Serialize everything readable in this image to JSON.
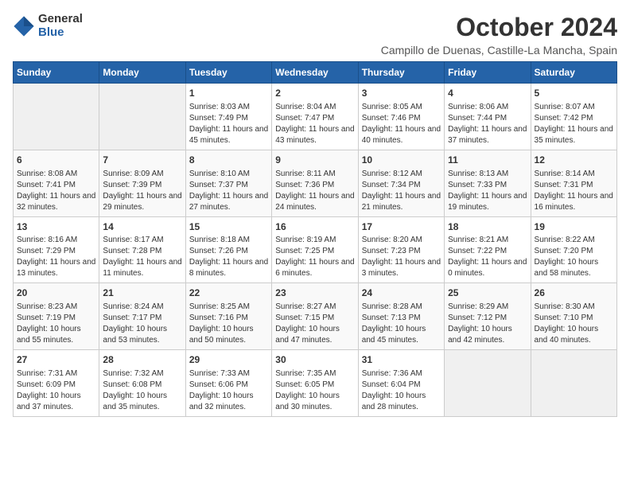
{
  "logo": {
    "general": "General",
    "blue": "Blue"
  },
  "title": {
    "month_year": "October 2024",
    "location": "Campillo de Duenas, Castille-La Mancha, Spain"
  },
  "calendar": {
    "headers": [
      "Sunday",
      "Monday",
      "Tuesday",
      "Wednesday",
      "Thursday",
      "Friday",
      "Saturday"
    ],
    "weeks": [
      [
        {
          "day": "",
          "info": ""
        },
        {
          "day": "",
          "info": ""
        },
        {
          "day": "1",
          "info": "Sunrise: 8:03 AM\nSunset: 7:49 PM\nDaylight: 11 hours and 45 minutes."
        },
        {
          "day": "2",
          "info": "Sunrise: 8:04 AM\nSunset: 7:47 PM\nDaylight: 11 hours and 43 minutes."
        },
        {
          "day": "3",
          "info": "Sunrise: 8:05 AM\nSunset: 7:46 PM\nDaylight: 11 hours and 40 minutes."
        },
        {
          "day": "4",
          "info": "Sunrise: 8:06 AM\nSunset: 7:44 PM\nDaylight: 11 hours and 37 minutes."
        },
        {
          "day": "5",
          "info": "Sunrise: 8:07 AM\nSunset: 7:42 PM\nDaylight: 11 hours and 35 minutes."
        }
      ],
      [
        {
          "day": "6",
          "info": "Sunrise: 8:08 AM\nSunset: 7:41 PM\nDaylight: 11 hours and 32 minutes."
        },
        {
          "day": "7",
          "info": "Sunrise: 8:09 AM\nSunset: 7:39 PM\nDaylight: 11 hours and 29 minutes."
        },
        {
          "day": "8",
          "info": "Sunrise: 8:10 AM\nSunset: 7:37 PM\nDaylight: 11 hours and 27 minutes."
        },
        {
          "day": "9",
          "info": "Sunrise: 8:11 AM\nSunset: 7:36 PM\nDaylight: 11 hours and 24 minutes."
        },
        {
          "day": "10",
          "info": "Sunrise: 8:12 AM\nSunset: 7:34 PM\nDaylight: 11 hours and 21 minutes."
        },
        {
          "day": "11",
          "info": "Sunrise: 8:13 AM\nSunset: 7:33 PM\nDaylight: 11 hours and 19 minutes."
        },
        {
          "day": "12",
          "info": "Sunrise: 8:14 AM\nSunset: 7:31 PM\nDaylight: 11 hours and 16 minutes."
        }
      ],
      [
        {
          "day": "13",
          "info": "Sunrise: 8:16 AM\nSunset: 7:29 PM\nDaylight: 11 hours and 13 minutes."
        },
        {
          "day": "14",
          "info": "Sunrise: 8:17 AM\nSunset: 7:28 PM\nDaylight: 11 hours and 11 minutes."
        },
        {
          "day": "15",
          "info": "Sunrise: 8:18 AM\nSunset: 7:26 PM\nDaylight: 11 hours and 8 minutes."
        },
        {
          "day": "16",
          "info": "Sunrise: 8:19 AM\nSunset: 7:25 PM\nDaylight: 11 hours and 6 minutes."
        },
        {
          "day": "17",
          "info": "Sunrise: 8:20 AM\nSunset: 7:23 PM\nDaylight: 11 hours and 3 minutes."
        },
        {
          "day": "18",
          "info": "Sunrise: 8:21 AM\nSunset: 7:22 PM\nDaylight: 11 hours and 0 minutes."
        },
        {
          "day": "19",
          "info": "Sunrise: 8:22 AM\nSunset: 7:20 PM\nDaylight: 10 hours and 58 minutes."
        }
      ],
      [
        {
          "day": "20",
          "info": "Sunrise: 8:23 AM\nSunset: 7:19 PM\nDaylight: 10 hours and 55 minutes."
        },
        {
          "day": "21",
          "info": "Sunrise: 8:24 AM\nSunset: 7:17 PM\nDaylight: 10 hours and 53 minutes."
        },
        {
          "day": "22",
          "info": "Sunrise: 8:25 AM\nSunset: 7:16 PM\nDaylight: 10 hours and 50 minutes."
        },
        {
          "day": "23",
          "info": "Sunrise: 8:27 AM\nSunset: 7:15 PM\nDaylight: 10 hours and 47 minutes."
        },
        {
          "day": "24",
          "info": "Sunrise: 8:28 AM\nSunset: 7:13 PM\nDaylight: 10 hours and 45 minutes."
        },
        {
          "day": "25",
          "info": "Sunrise: 8:29 AM\nSunset: 7:12 PM\nDaylight: 10 hours and 42 minutes."
        },
        {
          "day": "26",
          "info": "Sunrise: 8:30 AM\nSunset: 7:10 PM\nDaylight: 10 hours and 40 minutes."
        }
      ],
      [
        {
          "day": "27",
          "info": "Sunrise: 7:31 AM\nSunset: 6:09 PM\nDaylight: 10 hours and 37 minutes."
        },
        {
          "day": "28",
          "info": "Sunrise: 7:32 AM\nSunset: 6:08 PM\nDaylight: 10 hours and 35 minutes."
        },
        {
          "day": "29",
          "info": "Sunrise: 7:33 AM\nSunset: 6:06 PM\nDaylight: 10 hours and 32 minutes."
        },
        {
          "day": "30",
          "info": "Sunrise: 7:35 AM\nSunset: 6:05 PM\nDaylight: 10 hours and 30 minutes."
        },
        {
          "day": "31",
          "info": "Sunrise: 7:36 AM\nSunset: 6:04 PM\nDaylight: 10 hours and 28 minutes."
        },
        {
          "day": "",
          "info": ""
        },
        {
          "day": "",
          "info": ""
        }
      ]
    ]
  }
}
